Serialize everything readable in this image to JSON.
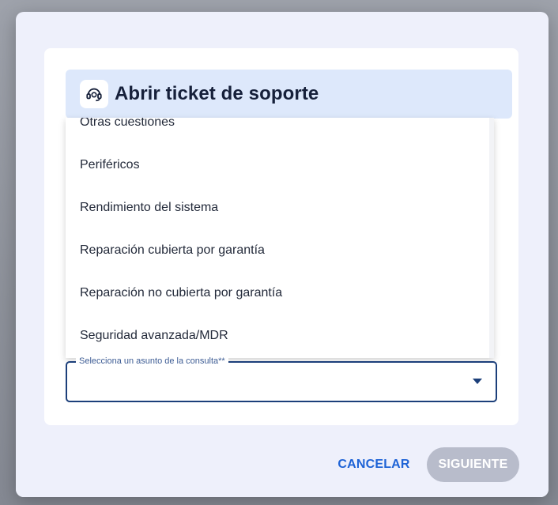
{
  "dialog": {
    "title": "Abrir ticket de soporte",
    "icon": "headset-icon"
  },
  "dropdown": {
    "items": [
      "Otras cuestiones",
      "Periféricos",
      "Rendimiento del sistema",
      "Reparación cubierta por garantía",
      "Reparación no cubierta por garantía",
      "Seguridad avanzada/MDR"
    ]
  },
  "select": {
    "label": "Selecciona un asunto de la consulta**",
    "value": ""
  },
  "footer": {
    "cancel_label": "CANCELAR",
    "next_label": "SIGUIENTE"
  },
  "colors": {
    "accent": "#1e63d6",
    "header_bg": "#dde8fb",
    "disabled_button": "#b8bccb"
  }
}
